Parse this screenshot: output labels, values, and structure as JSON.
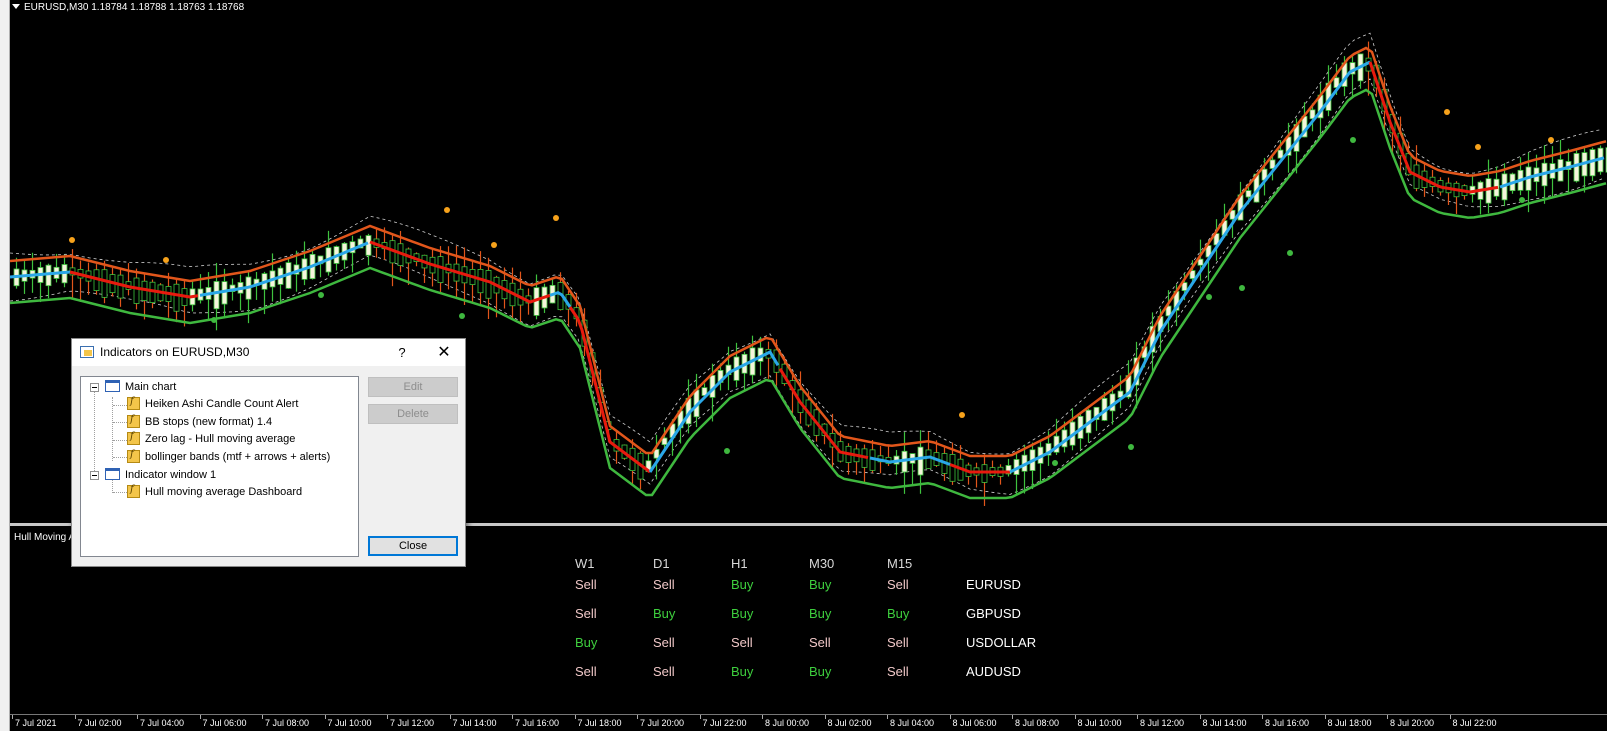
{
  "chart": {
    "symbol_header": "EURUSD,M30  1.18784 1.18788 1.18763 1.18768",
    "subwindow_title": "Hull Moving A",
    "time_labels": [
      "7 Jul 2021",
      "7 Jul 02:00",
      "7 Jul 04:00",
      "7 Jul 06:00",
      "7 Jul 08:00",
      "7 Jul 10:00",
      "7 Jul 12:00",
      "7 Jul 14:00",
      "7 Jul 16:00",
      "7 Jul 18:00",
      "7 Jul 20:00",
      "7 Jul 22:00",
      "8 Jul 00:00",
      "8 Jul 02:00",
      "8 Jul 04:00",
      "8 Jul 06:00",
      "8 Jul 08:00",
      "8 Jul 10:00",
      "8 Jul 12:00",
      "8 Jul 14:00",
      "8 Jul 16:00",
      "8 Jul 18:00",
      "8 Jul 20:00",
      "8 Jul 22:00"
    ],
    "colors": {
      "background": "#000000",
      "hull_up": "#2aa7e8",
      "hull_down": "#e81a0e",
      "bbstop_down": "#e2561b",
      "bbstop_up": "#3fb83f",
      "dots": "#f7a21b",
      "candle_bull": "#f5f5dc",
      "candle_outline": "#3ec23e",
      "wick_bear": "#e2561b"
    }
  },
  "dashboard": {
    "headers": [
      "W1",
      "D1",
      "H1",
      "M30",
      "M15"
    ],
    "rows": [
      {
        "values": [
          "Sell",
          "Sell",
          "Buy",
          "Buy",
          "Sell"
        ],
        "symbol": "EURUSD"
      },
      {
        "values": [
          "Sell",
          "Buy",
          "Buy",
          "Buy",
          "Buy"
        ],
        "symbol": "GBPUSD"
      },
      {
        "values": [
          "Buy",
          "Sell",
          "Sell",
          "Sell",
          "Sell"
        ],
        "symbol": "USDOLLAR"
      },
      {
        "values": [
          "Sell",
          "Sell",
          "Buy",
          "Buy",
          "Sell"
        ],
        "symbol": "AUDUSD"
      }
    ]
  },
  "dialog": {
    "title": "Indicators on EURUSD,M30",
    "help_label": "?",
    "close_glyph": "✕",
    "tree": {
      "main_chart_label": "Main chart",
      "main_indicators": [
        "Heiken Ashi Candle Count Alert",
        "BB stops (new format) 1.4",
        "Zero lag - Hull moving average",
        "bollinger bands (mtf + arrows + alerts)"
      ],
      "window1_label": "Indicator window 1",
      "window1_indicators": [
        "Hull moving average Dashboard"
      ]
    },
    "buttons": {
      "edit": "Edit",
      "delete": "Delete",
      "close": "Close"
    }
  }
}
